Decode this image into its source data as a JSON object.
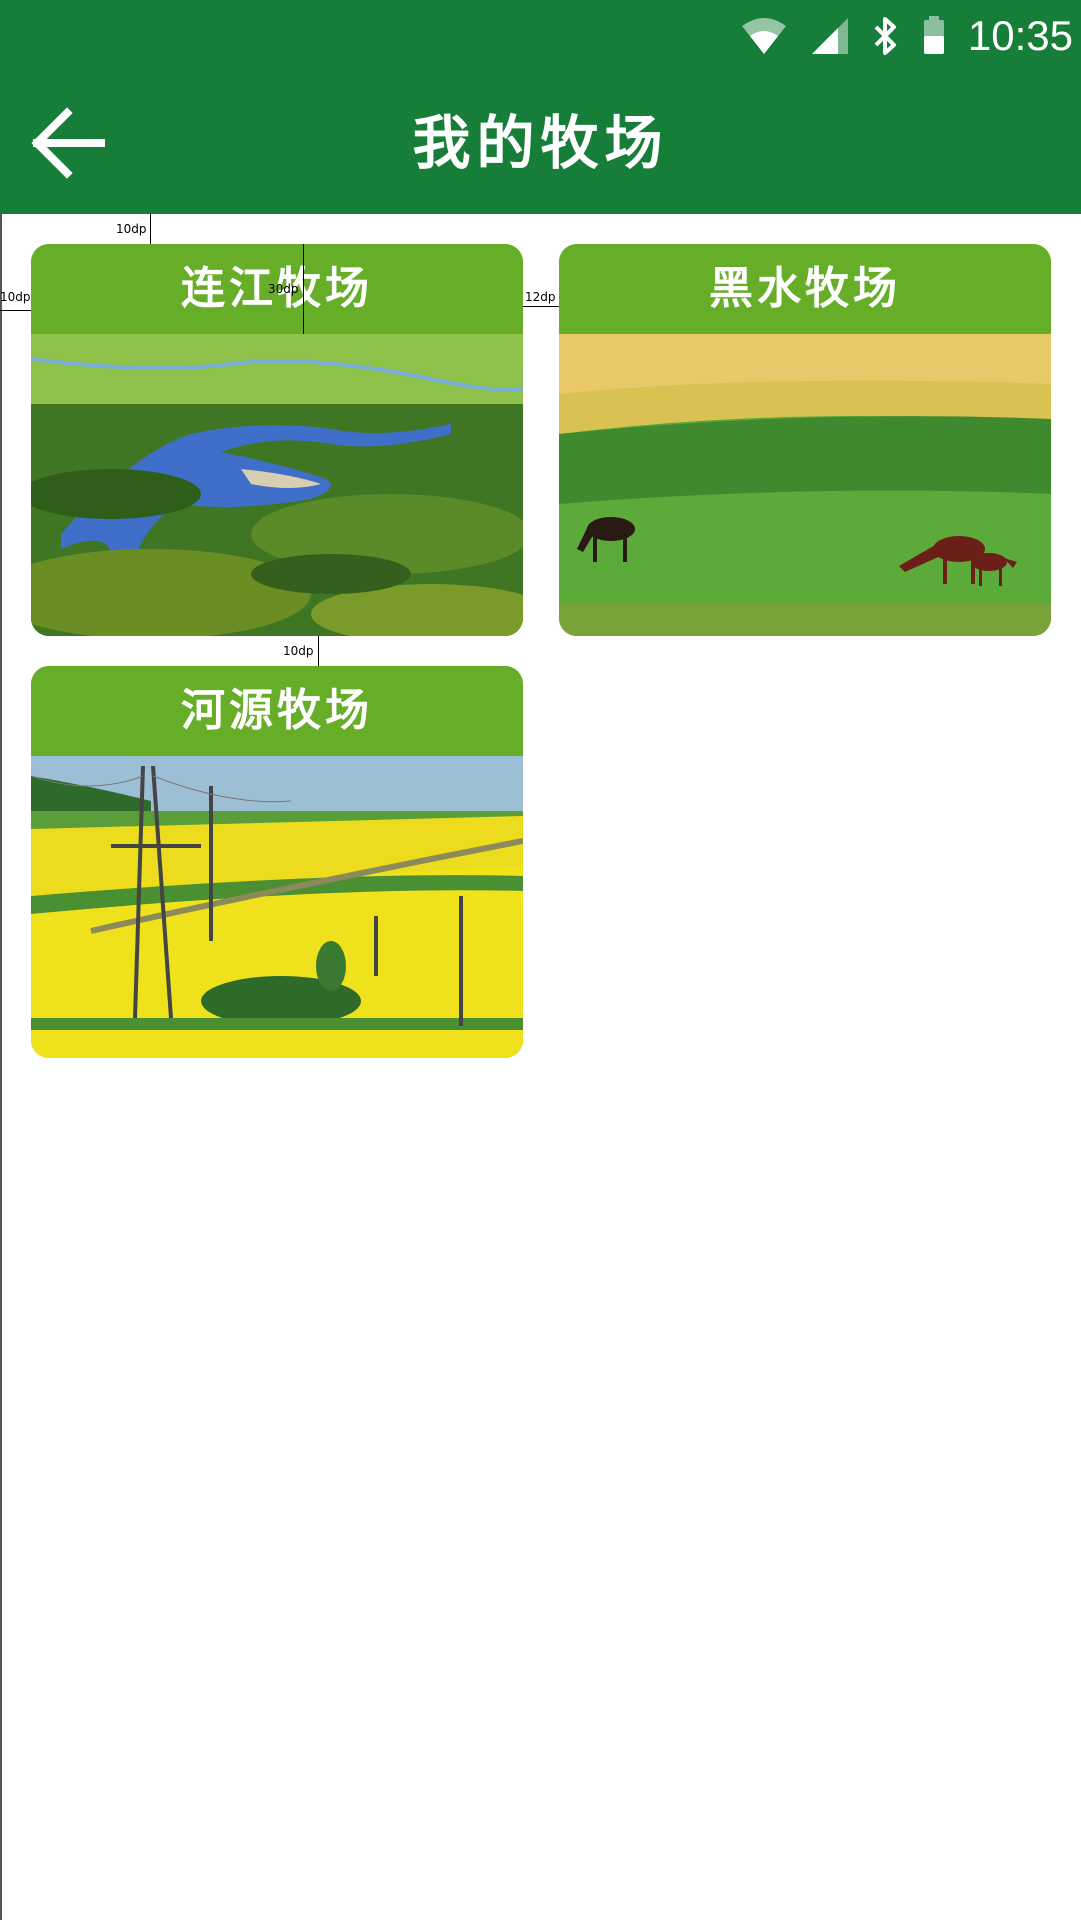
{
  "statusbar": {
    "time": "10:35",
    "icons": [
      "wifi-icon",
      "signal-icon",
      "bluetooth-icon",
      "battery-icon"
    ]
  },
  "appbar": {
    "title": "我的牧场",
    "back_icon": "arrow-left-icon"
  },
  "colors": {
    "primary": "#177e3a",
    "card_header": "#67ae28",
    "background": "#ffffff"
  },
  "pastures": [
    {
      "name": "连江牧场",
      "image": "river-wetland-landscape"
    },
    {
      "name": "黑水牧场",
      "image": "grassland-with-horses"
    },
    {
      "name": "河源牧场",
      "image": "rapeseed-field-with-power-lines"
    }
  ],
  "annotations": {
    "top_gap": "10dp",
    "left_gap": "10dp",
    "header_height": "30dp",
    "column_gap": "12dp",
    "row_gap": "10dp"
  }
}
